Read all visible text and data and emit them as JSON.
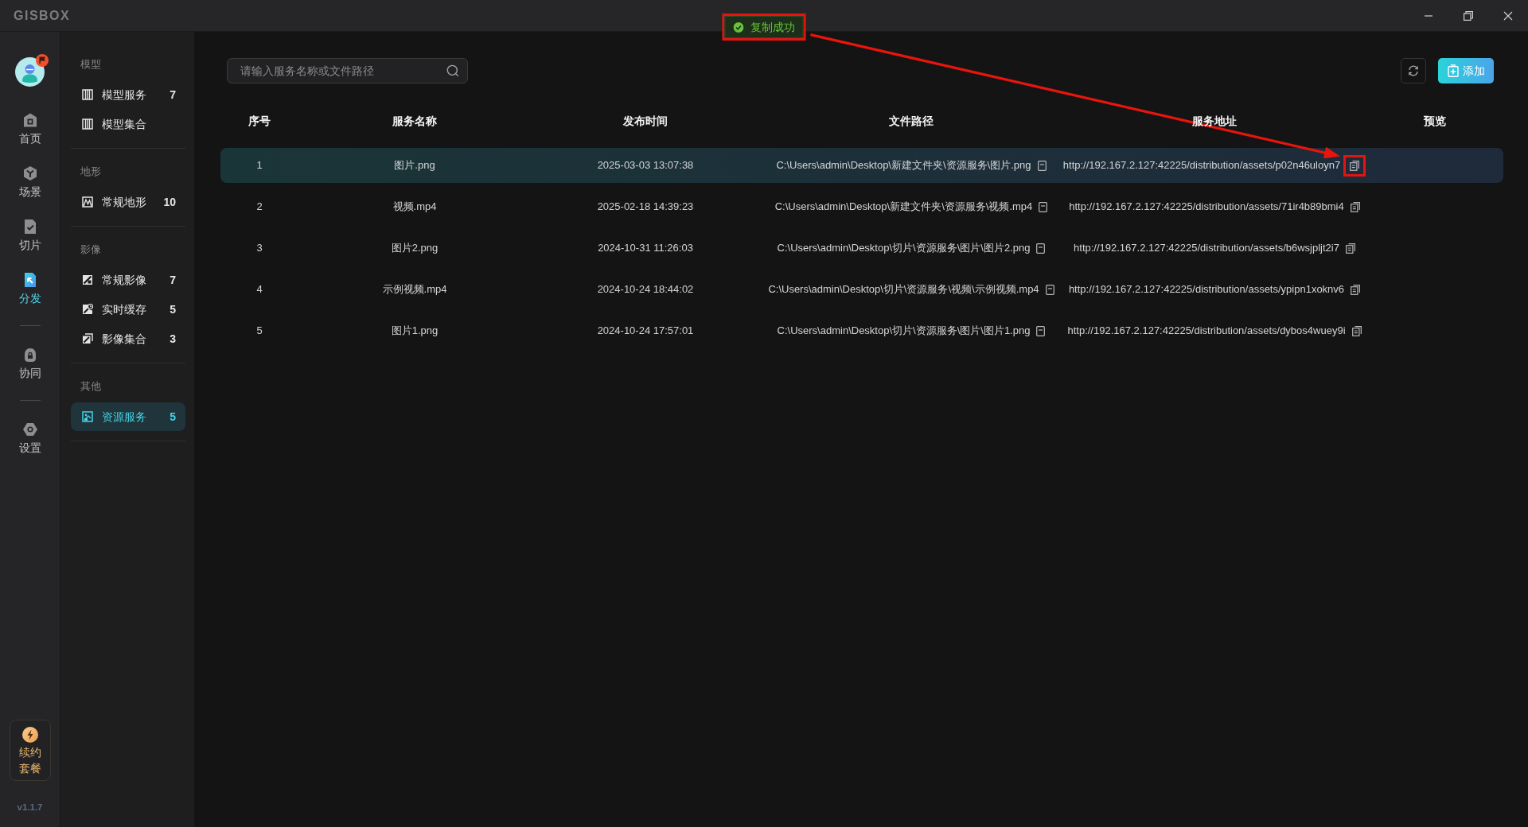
{
  "window": {
    "logo": "GISBOX"
  },
  "toast": {
    "text": "复制成功",
    "highlighted": true
  },
  "rail": {
    "groups": [
      {
        "items": [
          {
            "label": "首页",
            "selected": false
          },
          {
            "label": "场景",
            "selected": false
          },
          {
            "label": "切片",
            "selected": false
          },
          {
            "label": "分发",
            "selected": true
          }
        ]
      },
      {
        "items": [
          {
            "label": "协同",
            "selected": false
          }
        ]
      },
      {
        "items": [
          {
            "label": "设置",
            "selected": false
          }
        ]
      }
    ],
    "renew_button": "续约套餐",
    "version": "v1.1.7"
  },
  "sidebar": {
    "sections": [
      {
        "title": "模型",
        "items": [
          {
            "label": "模型服务",
            "count": "7",
            "selected": false
          },
          {
            "label": "模型集合",
            "selected": false
          }
        ]
      },
      {
        "title": "地形",
        "items": [
          {
            "label": "常规地形",
            "count": "10",
            "selected": false
          }
        ]
      },
      {
        "title": "影像",
        "items": [
          {
            "label": "常规影像",
            "count": "7",
            "selected": false
          },
          {
            "label": "实时缓存",
            "count": "5",
            "selected": false
          },
          {
            "label": "影像集合",
            "count": "3",
            "selected": false
          }
        ]
      },
      {
        "title": "其他",
        "items": [
          {
            "label": "资源服务",
            "count": "5",
            "selected": true
          }
        ]
      }
    ]
  },
  "search": {
    "placeholder": "请输入服务名称或文件路径"
  },
  "toolbar": {
    "add_button": "添加"
  },
  "table": {
    "columns": [
      "序号",
      "服务名称",
      "发布时间",
      "文件路径",
      "服务地址",
      "预览"
    ],
    "rows": [
      {
        "index": "1",
        "name": "图片.png",
        "published": "2025-03-03 13:07:38",
        "path": "C:\\Users\\admin\\Desktop\\新建文件夹\\资源服务\\图片.png",
        "url": "http://192.167.2.127:42225/distribution/assets/p02n46uloyn7",
        "selected": true,
        "url_highlighted": true
      },
      {
        "index": "2",
        "name": "视频.mp4",
        "published": "2025-02-18 14:39:23",
        "path": "C:\\Users\\admin\\Desktop\\新建文件夹\\资源服务\\视频.mp4",
        "url": "http://192.167.2.127:42225/distribution/assets/71ir4b89bmi4",
        "selected": false,
        "url_highlighted": false
      },
      {
        "index": "3",
        "name": "图片2.png",
        "published": "2024-10-31 11:26:03",
        "path": "C:\\Users\\admin\\Desktop\\切片\\资源服务\\图片\\图片2.png",
        "url": "http://192.167.2.127:42225/distribution/assets/b6wsjpljt2i7",
        "selected": false,
        "url_highlighted": false
      },
      {
        "index": "4",
        "name": "示例视频.mp4",
        "published": "2024-10-24 18:44:02",
        "path": "C:\\Users\\admin\\Desktop\\切片\\资源服务\\视频\\示例视频.mp4",
        "url": "http://192.167.2.127:42225/distribution/assets/ypipn1xoknv6",
        "selected": false,
        "url_highlighted": false
      },
      {
        "index": "5",
        "name": "图片1.png",
        "published": "2024-10-24 17:57:01",
        "path": "C:\\Users\\admin\\Desktop\\切片\\资源服务\\图片\\图片1.png",
        "url": "http://192.167.2.127:42225/distribution/assets/dybos4wuey9i",
        "selected": false,
        "url_highlighted": false
      }
    ]
  }
}
